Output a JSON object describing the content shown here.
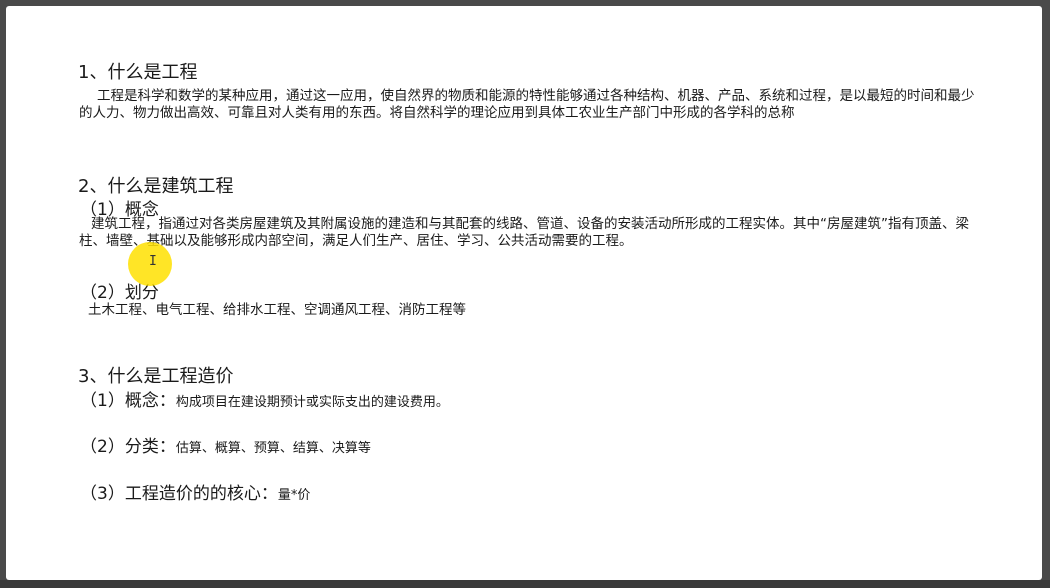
{
  "section1": {
    "heading": "1、什么是工程",
    "text": "工程是科学和数学的某种应用，通过这一应用，使自然界的物质和能源的特性能够通过各种结构、机器、产品、系统和过程，是以最短的时间和最少的人力、物力做出高效、可靠且对人类有用的东西。将自然科学的理论应用到具体工农业生产部门中形成的各学科的总称"
  },
  "section2": {
    "heading": "2、什么是建筑工程",
    "concept_title": "（1）概念",
    "concept_text": "建筑工程，指通过对各类房屋建筑及其附属设施的建造和与其配套的线路、管道、设备的安装活动所形成的工程实体。其中“房屋建筑”指有顶盖、梁柱、墙壁、基础以及能够形成内部空间，满足人们生产、居住、学习、公共活动需要的工程。",
    "division_title": "（2）划分",
    "division_text": "土木工程、电气工程、给排水工程、空调通风工程、消防工程等"
  },
  "section3": {
    "heading": "3、什么是工程造价",
    "item1_title": "（1）概念：",
    "item1_text": "构成项目在建设期预计或实际支出的建设费用。",
    "item2_title": "（2）分类：",
    "item2_text": "估算、概算、预算、结算、决算等",
    "item3_title": "（3）工程造价的的核心：",
    "item3_text": "量*价"
  },
  "colors": {
    "background": "#ffffff",
    "text": "#1a1a1a",
    "highlight": "#ffe000",
    "frame": "#4a4a4a"
  }
}
